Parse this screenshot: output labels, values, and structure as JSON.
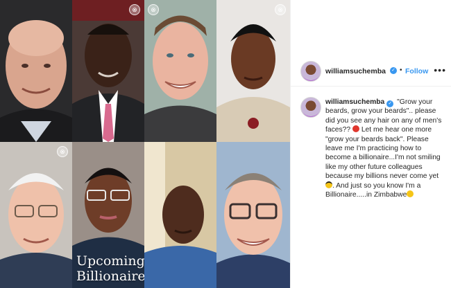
{
  "post": {
    "username": "williamsuchemba",
    "follow_label": "Follow",
    "header_separator": "•",
    "more_label": "•••",
    "verified_mark": "✓",
    "overlay_caption_line1": "Upcoming",
    "overlay_caption_line2": "Billionaire",
    "tile_icon_label": "⊗",
    "caption_parts": [
      "\"Grow your beards, grow your beards\".. please did you see any hair on any of men's faces??",
      "Let me hear one more \"grow your beards back\". Please leave me I'm practicing how to become a billionaire...I'm not smiling like my other future colleagues because my billions never come yet",
      ". And just so you know I'm a Billionaire.....in Zimbabwe"
    ],
    "emojis": [
      "angry-face-emoji",
      "sunglasses-face-emoji",
      "tears-of-joy-emoji"
    ]
  },
  "colors": {
    "accent_blue": "#3897f0",
    "text": "#262626",
    "border": "#efefef"
  }
}
